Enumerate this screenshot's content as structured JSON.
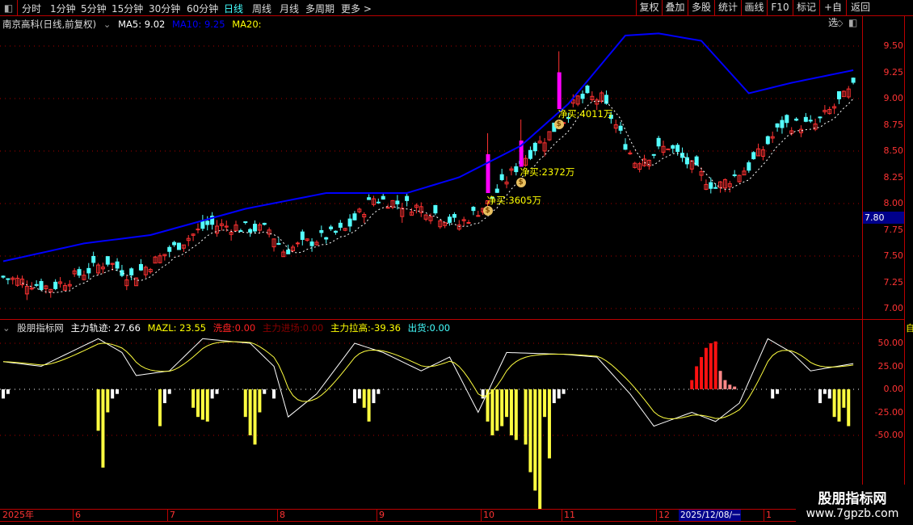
{
  "toolbar": {
    "periods": [
      "分时",
      "1分钟",
      "5分钟",
      "15分钟",
      "30分钟",
      "60分钟",
      "日线",
      "周线",
      "月线",
      "多周期",
      "更多 >"
    ],
    "active_period": "日线",
    "right_buttons": [
      "复权",
      "叠加",
      "多股",
      "统计",
      "画线",
      "F10",
      "标记",
      "+自选",
      "返回"
    ]
  },
  "main_header": {
    "title": "南京高科(日线,前复权)",
    "ma5": "MA5: 9.02",
    "ma10": "MA10: 9.25",
    "ma20": "MA20:"
  },
  "price_axis": {
    "ticks": [
      "9.50",
      "9.25",
      "9.00",
      "8.75",
      "8.50",
      "8.25",
      "8.00",
      "7.75",
      "7.50",
      "7.25",
      "7.00"
    ],
    "current_price": "7.80"
  },
  "indicator_header": {
    "name": "股朋指标网",
    "main_track": "主力轨迹: 27.66",
    "mazl": "MAZL: 23.55",
    "washout_label": "洗盘:",
    "washout": "0.00",
    "entry_label": "主力进场:",
    "entry": "0.00",
    "pull_up_label": "主力拉高:",
    "pull_up": "-39.36",
    "ship_label": "出货:",
    "ship": "0.00"
  },
  "indicator_axis": {
    "ticks": [
      "50.00",
      "25.00",
      "0.00",
      "-25.00",
      "-50.00"
    ]
  },
  "date_axis": {
    "labels": [
      "2025年",
      "6",
      "7",
      "8",
      "9",
      "10",
      "11",
      "12",
      "1"
    ],
    "cursor_date": "2025/12/08/一"
  },
  "annotations": [
    {
      "label": "净买:3605万",
      "day": 102
    },
    {
      "label": "净买:2372万",
      "day": 109
    },
    {
      "label": "净买:4011万",
      "day": 117
    }
  ],
  "watermark": {
    "name": "股朋指标网",
    "url": "www.7gpzb.com"
  },
  "right_strip": {
    "top": "自"
  },
  "colors": {
    "up": "#ff3232",
    "down": "#54ffff",
    "ma20": "#0000ff",
    "ma5": "#ffffff",
    "grid": "#b00000",
    "big": "#ff00ff",
    "yellow": "#ffff40"
  },
  "chart_data": {
    "type": "candlestick",
    "days": 180,
    "price_range": [
      6.95,
      9.65
    ],
    "close_keys": [
      [
        0,
        7.3
      ],
      [
        10,
        7.2
      ],
      [
        22,
        7.45
      ],
      [
        27,
        7.3
      ],
      [
        43,
        7.8
      ],
      [
        56,
        7.75
      ],
      [
        59,
        7.55
      ],
      [
        72,
        7.75
      ],
      [
        78,
        8.05
      ],
      [
        89,
        7.95
      ],
      [
        96,
        7.8
      ],
      [
        102,
        8.0
      ],
      [
        109,
        8.4
      ],
      [
        118,
        8.8
      ],
      [
        121,
        9.0
      ],
      [
        126,
        9.0
      ],
      [
        133,
        8.4
      ],
      [
        140,
        8.55
      ],
      [
        150,
        8.15
      ],
      [
        157,
        8.35
      ],
      [
        164,
        8.75
      ],
      [
        171,
        8.75
      ],
      [
        179,
        9.1
      ]
    ],
    "ma20_keys": [
      [
        0,
        7.45
      ],
      [
        17,
        7.62
      ],
      [
        31,
        7.7
      ],
      [
        51,
        7.95
      ],
      [
        68,
        8.1
      ],
      [
        85,
        8.1
      ],
      [
        96,
        8.25
      ],
      [
        109,
        8.55
      ],
      [
        119,
        8.95
      ],
      [
        131,
        9.6
      ],
      [
        138,
        9.62
      ],
      [
        147,
        9.55
      ],
      [
        157,
        9.05
      ],
      [
        166,
        9.15
      ],
      [
        179,
        9.27
      ]
    ],
    "big_candles": [
      [
        102,
        8.1,
        8.47
      ],
      [
        109,
        8.35,
        8.6
      ],
      [
        117,
        8.9,
        9.25
      ]
    ],
    "indicator_range": [
      -130,
      60
    ],
    "track_keys": [
      [
        0,
        30
      ],
      [
        8,
        25
      ],
      [
        20,
        55
      ],
      [
        25,
        40
      ],
      [
        28,
        15
      ],
      [
        35,
        20
      ],
      [
        42,
        55
      ],
      [
        52,
        50
      ],
      [
        57,
        25
      ],
      [
        60,
        -30
      ],
      [
        66,
        -5
      ],
      [
        74,
        50
      ],
      [
        80,
        40
      ],
      [
        88,
        20
      ],
      [
        94,
        35
      ],
      [
        100,
        -25
      ],
      [
        106,
        40
      ],
      [
        118,
        38
      ],
      [
        125,
        35
      ],
      [
        132,
        -5
      ],
      [
        137,
        -40
      ],
      [
        145,
        -25
      ],
      [
        150,
        -35
      ],
      [
        155,
        -15
      ],
      [
        161,
        55
      ],
      [
        166,
        40
      ],
      [
        170,
        20
      ],
      [
        179,
        28
      ]
    ],
    "bars": [
      [
        0,
        -10
      ],
      [
        1,
        -5
      ],
      [
        20,
        -45
      ],
      [
        21,
        -85
      ],
      [
        22,
        -25
      ],
      [
        23,
        -10
      ],
      [
        24,
        -5
      ],
      [
        33,
        -40
      ],
      [
        34,
        -15
      ],
      [
        35,
        -5
      ],
      [
        40,
        -20
      ],
      [
        41,
        -30
      ],
      [
        42,
        -33
      ],
      [
        43,
        -35
      ],
      [
        44,
        -10
      ],
      [
        45,
        -5
      ],
      [
        51,
        -30
      ],
      [
        52,
        -50
      ],
      [
        53,
        -60
      ],
      [
        54,
        -25
      ],
      [
        55,
        -5
      ],
      [
        57,
        -10
      ],
      [
        74,
        -15
      ],
      [
        75,
        -10
      ],
      [
        76,
        -20
      ],
      [
        77,
        -35
      ],
      [
        78,
        -15
      ],
      [
        79,
        -5
      ],
      [
        101,
        -10
      ],
      [
        102,
        -35
      ],
      [
        103,
        -50
      ],
      [
        104,
        -45
      ],
      [
        105,
        -40
      ],
      [
        106,
        -30
      ],
      [
        107,
        -50
      ],
      [
        108,
        -55
      ],
      [
        110,
        -60
      ],
      [
        111,
        -90
      ],
      [
        112,
        -110
      ],
      [
        113,
        -130
      ],
      [
        114,
        -30
      ],
      [
        115,
        -75
      ],
      [
        116,
        -15
      ],
      [
        117,
        -10
      ],
      [
        118,
        -5
      ],
      [
        145,
        10
      ],
      [
        146,
        25
      ],
      [
        147,
        35
      ],
      [
        148,
        45
      ],
      [
        149,
        50
      ],
      [
        150,
        52
      ],
      [
        151,
        20
      ],
      [
        152,
        10
      ],
      [
        153,
        5
      ],
      [
        154,
        3
      ],
      [
        162,
        -10
      ],
      [
        163,
        -5
      ],
      [
        172,
        -15
      ],
      [
        173,
        -5
      ],
      [
        174,
        -10
      ],
      [
        175,
        -30
      ],
      [
        176,
        -35
      ],
      [
        177,
        -20
      ],
      [
        178,
        -40
      ]
    ]
  }
}
